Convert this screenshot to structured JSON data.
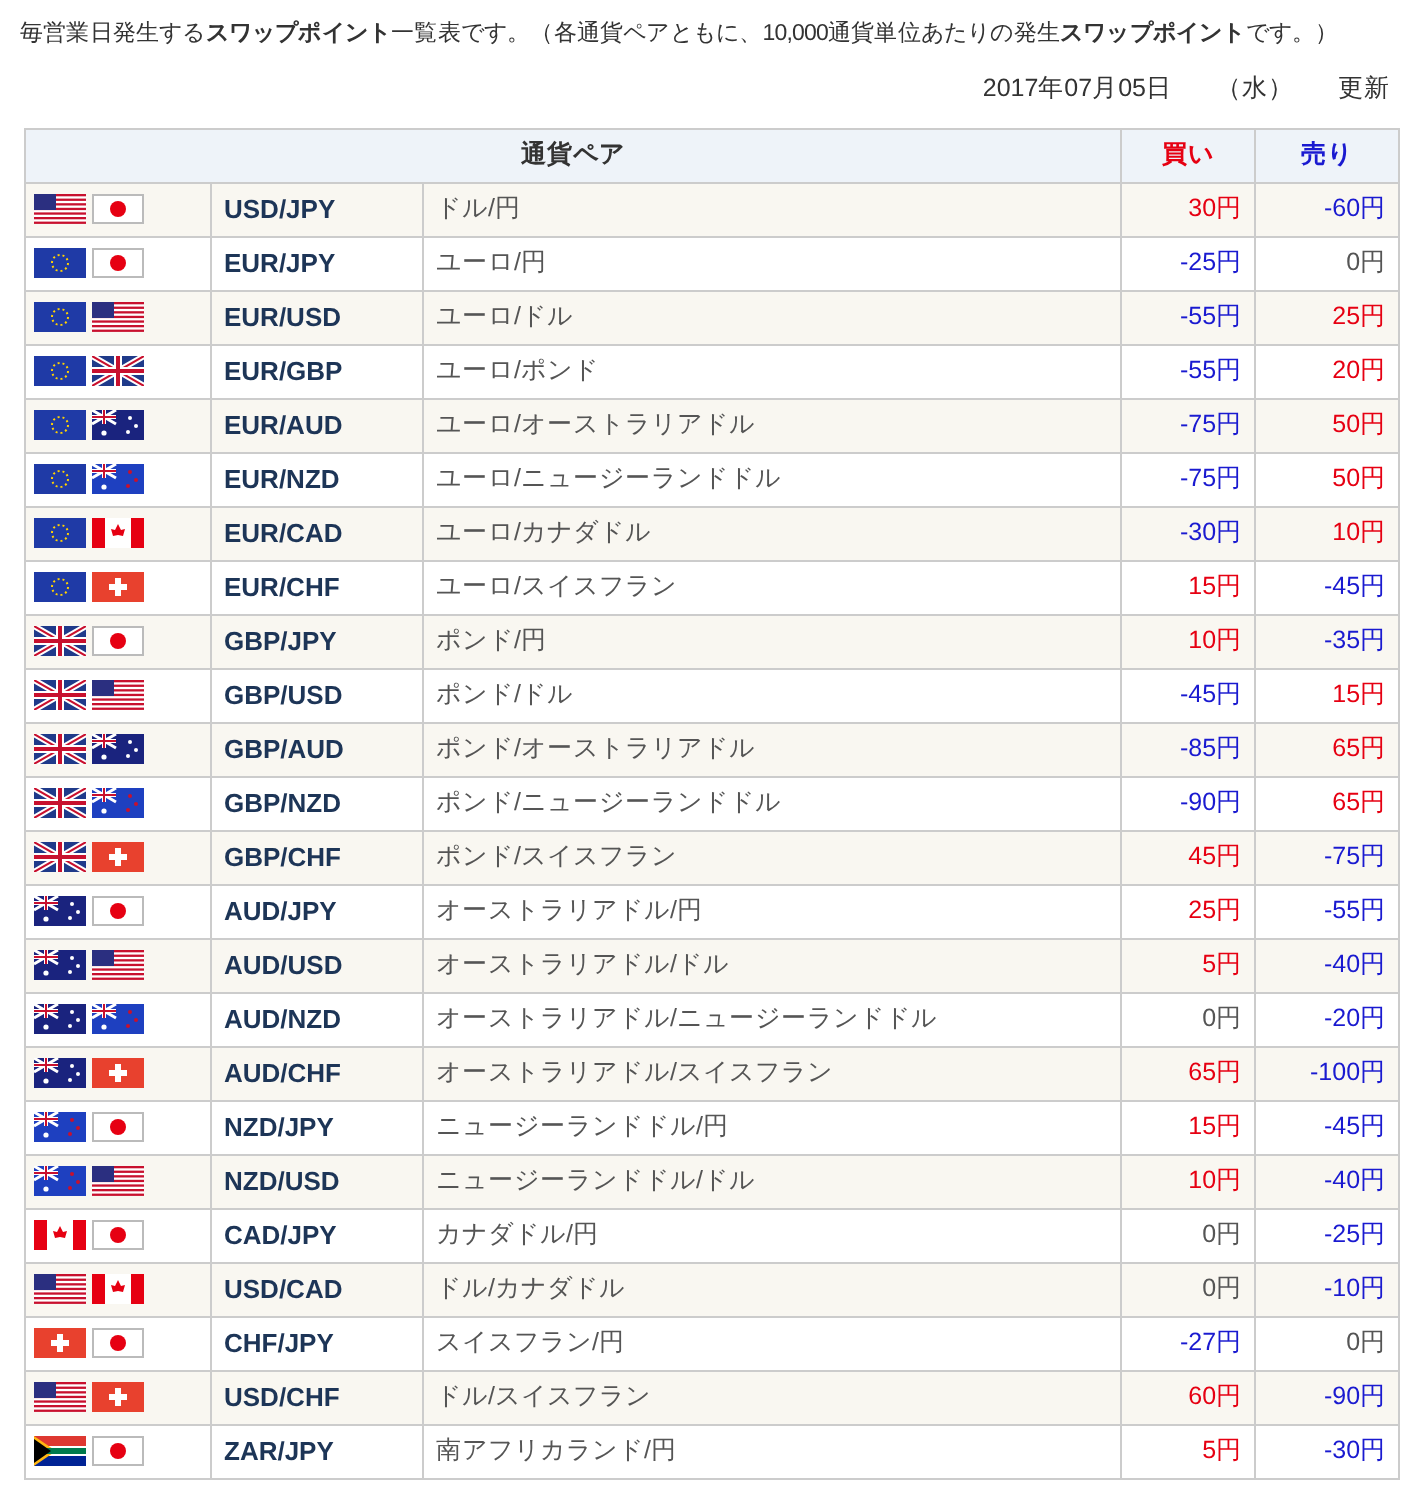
{
  "intro": "毎営業日発生する**スワップポイント**一覧表です。（各通貨ペアともに、10,000通貨単位あたりの発生**スワップポイント**です。）",
  "updated": {
    "date": "2017年07月05日",
    "weekday": "（水）",
    "label": "更新"
  },
  "table": {
    "columns": [
      "通貨ペア",
      "買い",
      "売り"
    ],
    "rows": [
      {
        "flags": [
          {
            "kind": "us"
          },
          {
            "kind": "jp"
          }
        ],
        "pair": "USD/JPY",
        "name": "ドル/円",
        "buy": {
          "text": "30円",
          "color": "#e60012"
        },
        "sell": {
          "text": "-60円",
          "color": "#1a1ad0"
        }
      },
      {
        "flags": [
          {
            "kind": "eu"
          },
          {
            "kind": "jp"
          }
        ],
        "pair": "EUR/JPY",
        "name": "ユーロ/円",
        "buy": {
          "text": "-25円",
          "color": "#1a1ad0"
        },
        "sell": {
          "text": "0円",
          "color": "#555555"
        }
      },
      {
        "flags": [
          {
            "kind": "eu"
          },
          {
            "kind": "us"
          }
        ],
        "pair": "EUR/USD",
        "name": "ユーロ/ドル",
        "buy": {
          "text": "-55円",
          "color": "#1a1ad0"
        },
        "sell": {
          "text": "25円",
          "color": "#e60012"
        }
      },
      {
        "flags": [
          {
            "kind": "eu"
          },
          {
            "kind": "gb"
          }
        ],
        "pair": "EUR/GBP",
        "name": "ユーロ/ポンド",
        "buy": {
          "text": "-55円",
          "color": "#1a1ad0"
        },
        "sell": {
          "text": "20円",
          "color": "#e60012"
        }
      },
      {
        "flags": [
          {
            "kind": "eu"
          },
          {
            "kind": "au"
          }
        ],
        "pair": "EUR/AUD",
        "name": "ユーロ/オーストラリアドル",
        "buy": {
          "text": "-75円",
          "color": "#1a1ad0"
        },
        "sell": {
          "text": "50円",
          "color": "#e60012"
        }
      },
      {
        "flags": [
          {
            "kind": "eu"
          },
          {
            "kind": "nz"
          }
        ],
        "pair": "EUR/NZD",
        "name": "ユーロ/ニュージーランドドル",
        "buy": {
          "text": "-75円",
          "color": "#1a1ad0"
        },
        "sell": {
          "text": "50円",
          "color": "#e60012"
        }
      },
      {
        "flags": [
          {
            "kind": "eu"
          },
          {
            "kind": "ca"
          }
        ],
        "pair": "EUR/CAD",
        "name": "ユーロ/カナダドル",
        "buy": {
          "text": "-30円",
          "color": "#1a1ad0"
        },
        "sell": {
          "text": "10円",
          "color": "#e60012"
        }
      },
      {
        "flags": [
          {
            "kind": "eu"
          },
          {
            "kind": "ch"
          }
        ],
        "pair": "EUR/CHF",
        "name": "ユーロ/スイスフラン",
        "buy": {
          "text": "15円",
          "color": "#e60012"
        },
        "sell": {
          "text": "-45円",
          "color": "#1a1ad0"
        }
      },
      {
        "flags": [
          {
            "kind": "gb"
          },
          {
            "kind": "jp"
          }
        ],
        "pair": "GBP/JPY",
        "name": "ポンド/円",
        "buy": {
          "text": "10円",
          "color": "#e60012"
        },
        "sell": {
          "text": "-35円",
          "color": "#1a1ad0"
        }
      },
      {
        "flags": [
          {
            "kind": "gb"
          },
          {
            "kind": "us"
          }
        ],
        "pair": "GBP/USD",
        "name": "ポンド/ドル",
        "buy": {
          "text": "-45円",
          "color": "#1a1ad0"
        },
        "sell": {
          "text": "15円",
          "color": "#e60012"
        }
      },
      {
        "flags": [
          {
            "kind": "gb"
          },
          {
            "kind": "au"
          }
        ],
        "pair": "GBP/AUD",
        "name": "ポンド/オーストラリアドル",
        "buy": {
          "text": "-85円",
          "color": "#1a1ad0"
        },
        "sell": {
          "text": "65円",
          "color": "#e60012"
        }
      },
      {
        "flags": [
          {
            "kind": "gb"
          },
          {
            "kind": "nz"
          }
        ],
        "pair": "GBP/NZD",
        "name": "ポンド/ニュージーランドドル",
        "buy": {
          "text": "-90円",
          "color": "#1a1ad0"
        },
        "sell": {
          "text": "65円",
          "color": "#e60012"
        }
      },
      {
        "flags": [
          {
            "kind": "gb"
          },
          {
            "kind": "ch"
          }
        ],
        "pair": "GBP/CHF",
        "name": "ポンド/スイスフラン",
        "buy": {
          "text": "45円",
          "color": "#e60012"
        },
        "sell": {
          "text": "-75円",
          "color": "#1a1ad0"
        }
      },
      {
        "flags": [
          {
            "kind": "au"
          },
          {
            "kind": "jp"
          }
        ],
        "pair": "AUD/JPY",
        "name": "オーストラリアドル/円",
        "buy": {
          "text": "25円",
          "color": "#e60012"
        },
        "sell": {
          "text": "-55円",
          "color": "#1a1ad0"
        }
      },
      {
        "flags": [
          {
            "kind": "au"
          },
          {
            "kind": "us"
          }
        ],
        "pair": "AUD/USD",
        "name": "オーストラリアドル/ドル",
        "buy": {
          "text": "5円",
          "color": "#e60012"
        },
        "sell": {
          "text": "-40円",
          "color": "#1a1ad0"
        }
      },
      {
        "flags": [
          {
            "kind": "au"
          },
          {
            "kind": "nz"
          }
        ],
        "pair": "AUD/NZD",
        "name": "オーストラリアドル/ニュージーランドドル",
        "buy": {
          "text": "0円",
          "color": "#555555"
        },
        "sell": {
          "text": "-20円",
          "color": "#1a1ad0"
        }
      },
      {
        "flags": [
          {
            "kind": "au"
          },
          {
            "kind": "ch"
          }
        ],
        "pair": "AUD/CHF",
        "name": "オーストラリアドル/スイスフラン",
        "buy": {
          "text": "65円",
          "color": "#e60012"
        },
        "sell": {
          "text": "-100円",
          "color": "#1a1ad0"
        }
      },
      {
        "flags": [
          {
            "kind": "nz"
          },
          {
            "kind": "jp"
          }
        ],
        "pair": "NZD/JPY",
        "name": "ニュージーランドドル/円",
        "buy": {
          "text": "15円",
          "color": "#e60012"
        },
        "sell": {
          "text": "-45円",
          "color": "#1a1ad0"
        }
      },
      {
        "flags": [
          {
            "kind": "nz"
          },
          {
            "kind": "us"
          }
        ],
        "pair": "NZD/USD",
        "name": "ニュージーランドドル/ドル",
        "buy": {
          "text": "10円",
          "color": "#e60012"
        },
        "sell": {
          "text": "-40円",
          "color": "#1a1ad0"
        }
      },
      {
        "flags": [
          {
            "kind": "ca"
          },
          {
            "kind": "jp"
          }
        ],
        "pair": "CAD/JPY",
        "name": "カナダドル/円",
        "buy": {
          "text": "0円",
          "color": "#555555"
        },
        "sell": {
          "text": "-25円",
          "color": "#1a1ad0"
        }
      },
      {
        "flags": [
          {
            "kind": "us"
          },
          {
            "kind": "ca"
          }
        ],
        "pair": "USD/CAD",
        "name": "ドル/カナダドル",
        "buy": {
          "text": "0円",
          "color": "#555555"
        },
        "sell": {
          "text": "-10円",
          "color": "#1a1ad0"
        }
      },
      {
        "flags": [
          {
            "kind": "ch"
          },
          {
            "kind": "jp"
          }
        ],
        "pair": "CHF/JPY",
        "name": "スイスフラン/円",
        "buy": {
          "text": "-27円",
          "color": "#1a1ad0"
        },
        "sell": {
          "text": "0円",
          "color": "#555555"
        }
      },
      {
        "flags": [
          {
            "kind": "us"
          },
          {
            "kind": "ch"
          }
        ],
        "pair": "USD/CHF",
        "name": "ドル/スイスフラン",
        "buy": {
          "text": "60円",
          "color": "#e60012"
        },
        "sell": {
          "text": "-90円",
          "color": "#1a1ad0"
        }
      },
      {
        "flags": [
          {
            "kind": "za"
          },
          {
            "kind": "jp"
          }
        ],
        "pair": "ZAR/JPY",
        "name": "南アフリカランド/円",
        "buy": {
          "text": "5円",
          "color": "#e60012"
        },
        "sell": {
          "text": "-30円",
          "color": "#1a1ad0"
        }
      }
    ]
  }
}
